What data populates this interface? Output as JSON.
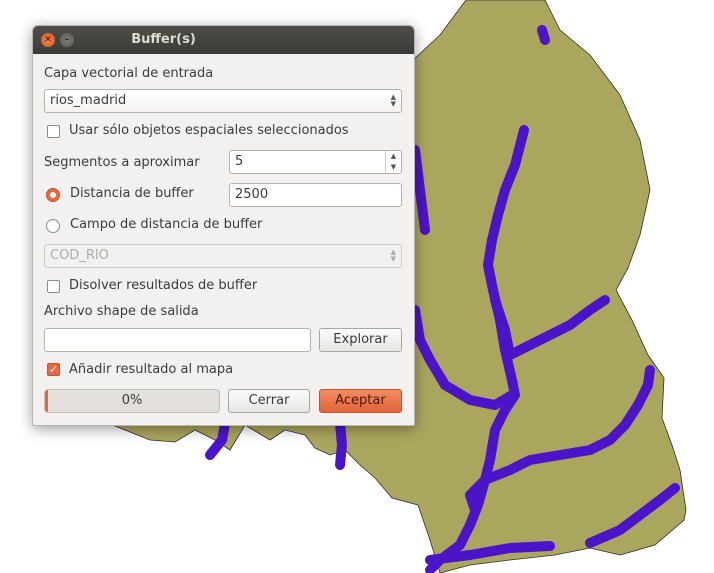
{
  "dialog": {
    "title": "Buffer(s)",
    "input_layer_label": "Capa vectorial de entrada",
    "input_layer_value": "rios_madrid",
    "selected_only": {
      "label": "Usar sólo objetos espaciales seleccionados",
      "checked": false
    },
    "segments_label": "Segmentos a aproximar",
    "segments_value": "5",
    "buffer_distance": {
      "label": "Distancia de buffer",
      "value": "2500",
      "selected": true
    },
    "buffer_field": {
      "label": "Campo de distancia de buffer",
      "selected": false,
      "value": "COD_RIO"
    },
    "dissolve": {
      "label": "Disolver resultados de buffer",
      "checked": false
    },
    "output_label": "Archivo shape de salida",
    "output_value": "",
    "browse_label": "Explorar",
    "add_to_map": {
      "label": "Añadir resultado al mapa",
      "checked": true
    },
    "progress_text": "0%",
    "progress_value": 0,
    "close_label": "Cerrar",
    "accept_label": "Aceptar"
  },
  "colors": {
    "map_fill": "#aba65e",
    "river": "#4c14c8",
    "accent": "#e9693f"
  }
}
